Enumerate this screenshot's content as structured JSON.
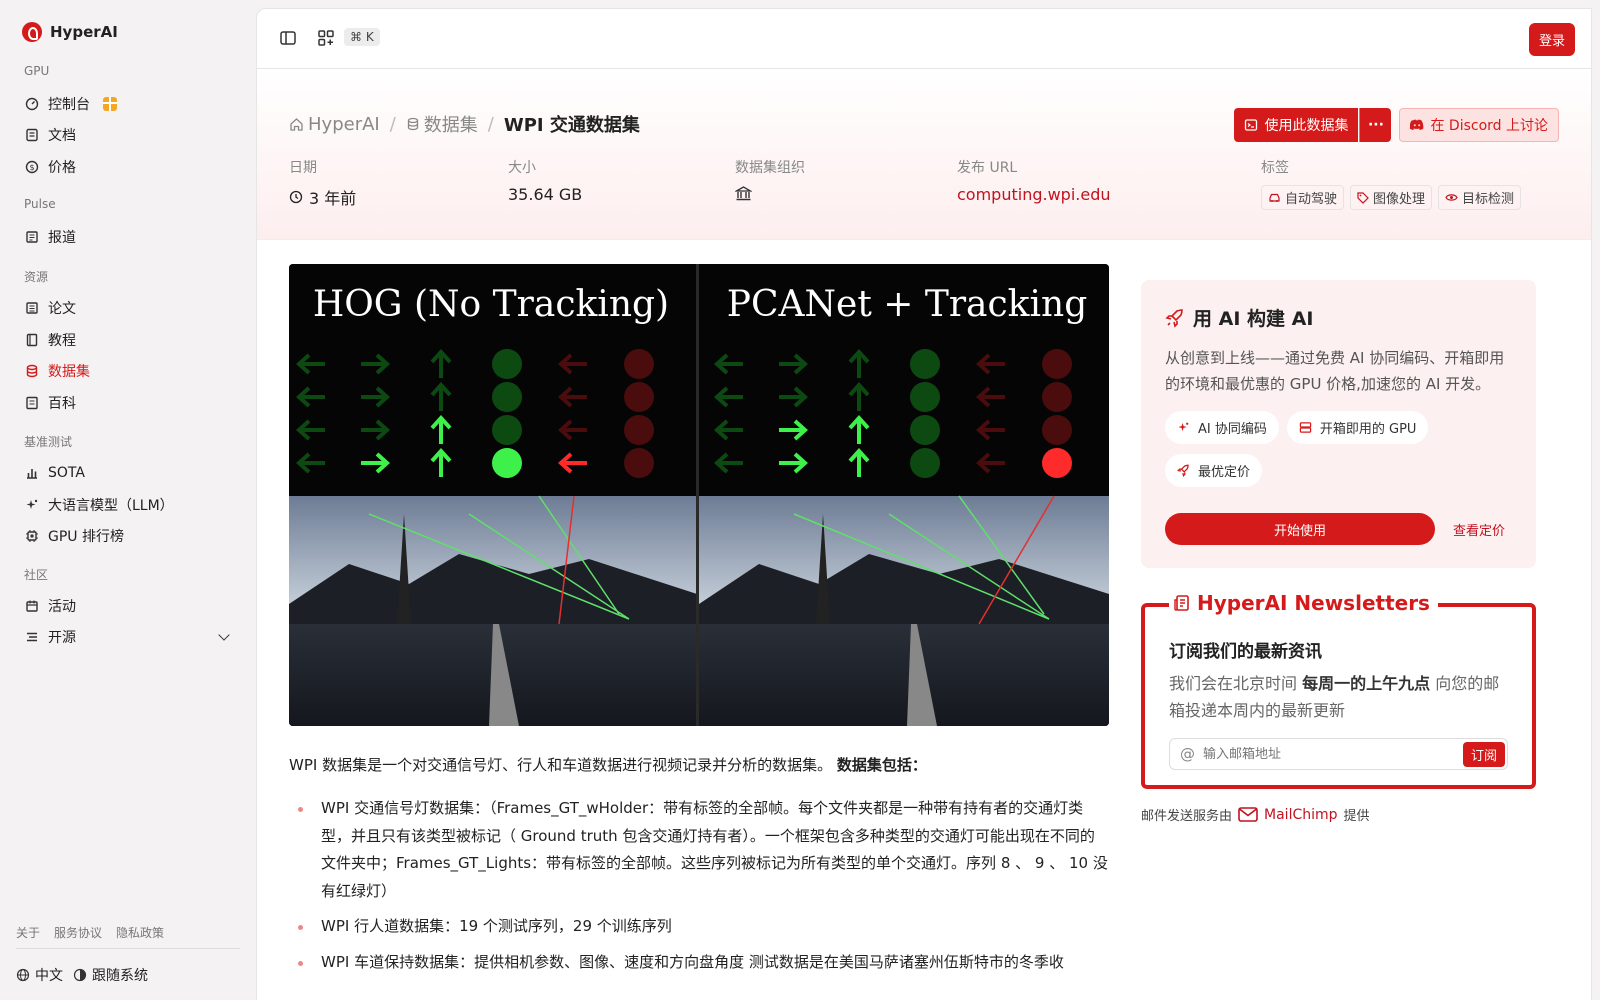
{
  "brand": {
    "name": "HyperAI"
  },
  "sidebar": {
    "sections": {
      "gpu": "GPU",
      "pulse": "Pulse",
      "resources": "资源",
      "benchmark": "基准测试",
      "community": "社区"
    },
    "items": {
      "console": "控制台",
      "docs": "文档",
      "pricing": "价格",
      "news": "报道",
      "papers": "论文",
      "tutorials": "教程",
      "datasets": "数据集",
      "wiki": "百科",
      "sota": "SOTA",
      "llm": "大语言模型（LLM）",
      "gpu_rank": "GPU 排行榜",
      "events": "活动",
      "open_source": "开源"
    },
    "footer": {
      "about": "关于",
      "terms": "服务协议",
      "privacy": "隐私政策"
    },
    "bottom": {
      "language": "中文",
      "theme": "跟随系统"
    }
  },
  "topbar": {
    "shortcut": "⌘ K",
    "login": "登录"
  },
  "breadcrumb": {
    "home": "HyperAI",
    "section": "数据集",
    "current": "WPI 交通数据集"
  },
  "actions": {
    "use_dataset": "使用此数据集",
    "more": "···",
    "discord": "在 Discord 上讨论"
  },
  "meta": {
    "date_label": "日期",
    "date_value": "3 年前",
    "size_label": "大小",
    "size_value": "35.64 GB",
    "org_label": "数据集组织",
    "url_label": "发布 URL",
    "url_value": "computing.wpi.edu",
    "tags_label": "标签",
    "tags": [
      "自动驾驶",
      "图像处理",
      "目标检测"
    ]
  },
  "hero": {
    "left_title": "HOG (No Tracking)",
    "right_title": "PCANet + Tracking"
  },
  "content": {
    "intro": "WPI 数据集是一个对交通信号灯、行人和车道数据进行视频记录并分析的数据集。 ",
    "intro_bold": "数据集包括：",
    "bullets": [
      "WPI 交通信号灯数据集：（Frames_GT_wHolder：带有标签的全部帧。每个文件夹都是一种带有持有者的交通灯类型，并且只有该类型被标记（ Ground truth 包含交通灯持有者）。一个框架包含多种类型的交通灯可能出现在不同的文件夹中；Frames_GT_Lights：带有标签的全部帧。这些序列被标记为所有类型的单个交通灯。序列 8 、 9 、 10 没有红绿灯）",
      "WPI 行人道数据集：19 个测试序列，29 个训练序列",
      "WPI 车道保持数据集：提供相机参数、图像、速度和方向盘角度 测试数据是在美国马萨诸塞州伍斯特市的冬季收"
    ]
  },
  "ai_card": {
    "title": "用 AI 构建 AI",
    "desc": "从创意到上线——通过免费 AI 协同编码、开箱即用的环境和最优惠的 GPU 价格,加速您的 AI 开发。",
    "pills": [
      "AI 协同编码",
      "开箱即用的 GPU",
      "最优定价"
    ],
    "start": "开始使用",
    "pricing": "查看定价"
  },
  "newsletter": {
    "title": "HyperAI Newsletters",
    "heading": "订阅我们的最新资讯",
    "text_pre": "我们会在北京时间 ",
    "text_bold": "每周一的上午九点",
    "text_post": " 向您的邮箱投递本周内的最新更新",
    "placeholder": "输入邮箱地址",
    "subscribe": "订阅"
  },
  "mailchimp": {
    "pre": "邮件发送服务由",
    "name": "MailChimp",
    "post": "提供"
  },
  "colors": {
    "accent": "#d41a1a",
    "link": "#c1121f",
    "tint": "#fcf0f0"
  }
}
